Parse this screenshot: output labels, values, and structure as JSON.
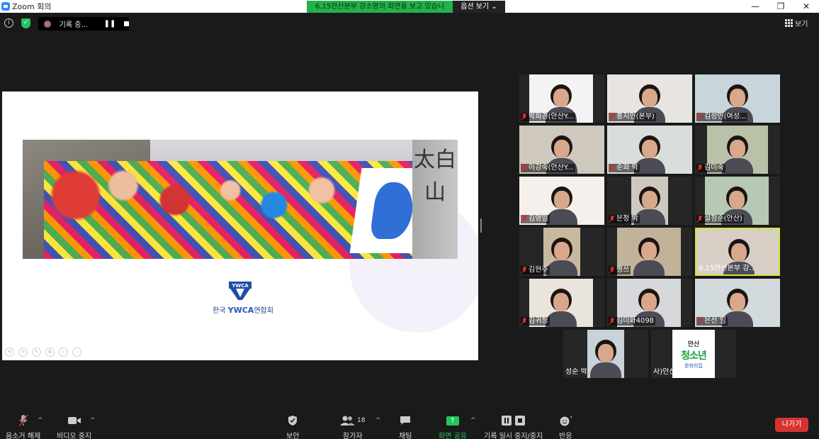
{
  "window": {
    "title": "Zoom 회의",
    "min": "—",
    "max": "❐",
    "close": "✕"
  },
  "share_banner": {
    "message": "6.15안산본부 강소영의 화면을 보고 있습니다.",
    "options_label": "옵션 보기 ⌄"
  },
  "info_icon": "i",
  "recording": {
    "label": "기록 중...",
    "pause": "❚❚"
  },
  "view_button": {
    "label": "보기"
  },
  "slide": {
    "stele_text": "太白山",
    "logo_text": "YWCA",
    "org_prefix": "한국",
    "org_brand": "YWCA",
    "org_suffix": "연합회",
    "tools": [
      "⟲",
      "⟳",
      "✎",
      "⧉",
      "⌕",
      "⋯"
    ]
  },
  "participants": [
    {
      "name": "박희경(안산Y...",
      "muted": true
    },
    {
      "name": "홍지인(본부)",
      "muted": true
    },
    {
      "name": "김성민(여성...",
      "muted": true
    },
    {
      "name": "이강숙(안산Y...",
      "muted": true
    },
    {
      "name": "순화 박",
      "muted": true
    },
    {
      "name": "김미숙",
      "muted": true
    },
    {
      "name": "김영임",
      "muted": true
    },
    {
      "name": "은정 박",
      "muted": true
    },
    {
      "name": "설점순(안산)",
      "muted": true
    },
    {
      "name": "김현주",
      "muted": true
    },
    {
      "name": "짱쓰",
      "muted": true
    },
    {
      "name": "6.15안산본부 강...",
      "muted": false,
      "active": true
    },
    {
      "name": "김귀정",
      "muted": true
    },
    {
      "name": "김미화4098",
      "muted": true
    },
    {
      "name": "은선 임",
      "muted": true
    },
    {
      "name": "성순 박",
      "muted": false
    },
    {
      "name": "사)안산YWCA",
      "muted": false,
      "logo": {
        "line1": "안산",
        "line2": "청소년",
        "line3": "문화의집"
      }
    }
  ],
  "toolbar": {
    "unmute": "음소거 해제",
    "video": "비디오 중지",
    "security": "보안",
    "participants": "참가자",
    "participants_count": "18",
    "chat": "채팅",
    "share": "화면 공유",
    "record": "기록 일시 중지/중지",
    "reactions": "반응",
    "leave": "나가기",
    "caret": "^",
    "share_arrow": "↑",
    "reaction_plus": "+"
  },
  "colors": {
    "share_green": "#22b14c",
    "leave_red": "#d93232",
    "active_border": "#d6e33d",
    "mute_red": "#e02828"
  }
}
